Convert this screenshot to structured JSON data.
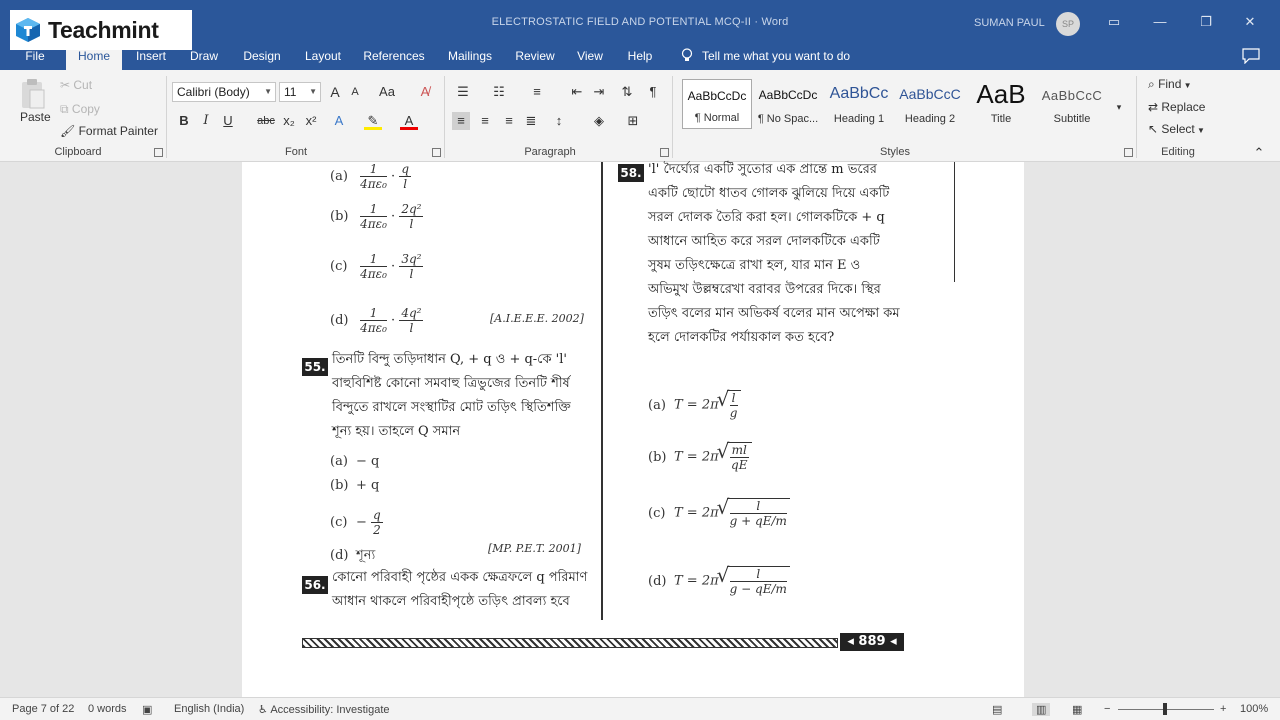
{
  "brand": {
    "name": "Teachmint"
  },
  "titlebar": {
    "doc_title": "ELECTROSTATIC FIELD AND POTENTIAL MCQ-II  ·  Word",
    "user": "SUMAN PAUL",
    "avatar": "SP"
  },
  "tabs": [
    "File",
    "Home",
    "Insert",
    "Draw",
    "Design",
    "Layout",
    "References",
    "Mailings",
    "Review",
    "View",
    "Help"
  ],
  "tell_me": "Tell me what you want to do",
  "clipboard": {
    "paste": "Paste",
    "cut": "Cut",
    "copy": "Copy",
    "format_painter": "Format Painter",
    "label": "Clipboard"
  },
  "font": {
    "name": "Calibri (Body)",
    "size": "11",
    "label": "Font",
    "bold": "B",
    "italic": "I",
    "underline": "U",
    "strike": "abc",
    "subscript": "x₂",
    "superscript": "x²",
    "grow": "A",
    "shrink": "A",
    "case": "Aa"
  },
  "paragraph": {
    "label": "Paragraph"
  },
  "styles": {
    "label": "Styles",
    "items": [
      {
        "preview": "AaBbCcDc",
        "name": "¶ Normal"
      },
      {
        "preview": "AaBbCcDc",
        "name": "¶ No Spac..."
      },
      {
        "preview": "AaBbCc",
        "name": "Heading 1"
      },
      {
        "preview": "AaBbCcC",
        "name": "Heading 2"
      },
      {
        "preview": "AaB",
        "name": "Title"
      },
      {
        "preview": "AaBbCcC",
        "name": "Subtitle"
      }
    ]
  },
  "editing": {
    "find": "Find",
    "replace": "Replace",
    "select": "Select",
    "label": "Editing"
  },
  "document": {
    "left": {
      "q54_options": [
        {
          "label": "(a)",
          "num": "1",
          "den": "4πε₀",
          "num2": "q",
          "den2": "l"
        },
        {
          "label": "(b)",
          "num": "1",
          "den": "4πε₀",
          "num2": "2q²",
          "den2": "l"
        },
        {
          "label": "(c)",
          "num": "1",
          "den": "4πε₀",
          "num2": "3q²",
          "den2": "l"
        },
        {
          "label": "(d)",
          "num": "1",
          "den": "4πε₀",
          "num2": "4q²",
          "den2": "l"
        }
      ],
      "q54_ref": "[A.I.E.E.E. 2002]",
      "q55_num": "55.",
      "q55_text": "তিনটি বিন্দু তড়িদাধান Q, + q ও + q-কে 'l' বাহুবিশিষ্ট কোনো সমবাহু ত্রিভুজের তিনটি শীর্ষ বিন্দুতে রাখলে সংস্থাটির মোট তড়িৎ স্থিতিশক্তি শূন্য হয়। তাহলে Q সমান",
      "q55_options": [
        {
          "label": "(a)",
          "text": "− q"
        },
        {
          "label": "(b)",
          "text": "+ q"
        },
        {
          "label": "(c)",
          "text": "−",
          "num": "q",
          "den": "2"
        },
        {
          "label": "(d)",
          "text": "শূন্য"
        }
      ],
      "q55_ref": "[MP. P.E.T. 2001]",
      "q56_num": "56.",
      "q56_text": "কোনো পরিবাহী পৃষ্ঠের একক ক্ষেত্রফলে q পরিমাণ আধান থাকলে পরিবাহীপৃষ্ঠে তড়িৎ প্রাবল্য হবে"
    },
    "right": {
      "q58_num": "58.",
      "q58_text": "'l' দৈর্ঘ্যের একটি সুতোর এক প্রান্তে m ভরের একটি ছোটো ধাতব গোলক ঝুলিয়ে দিয়ে একটি সরল দোলক তৈরি করা হল। গোলকটিকে + q আধানে আহিত করে সরল দোলকটিকে একটি সুষম তড়িৎক্ষেত্রে রাখা হল, যার মান E ও অভিমুখ উল্লম্বরেখা বরাবর উপরের দিকে। স্থির তড়িৎ বলের মান অভিকর্ষ বলের মান অপেক্ষা কম হলে দোলকটির পর্যায়কাল কত হবে?",
      "q58_options": [
        {
          "label": "(a)",
          "prefix": "T = 2π",
          "num": "l",
          "den": "g"
        },
        {
          "label": "(b)",
          "prefix": "T = 2π",
          "num": "ml",
          "den": "qE"
        },
        {
          "label": "(c)",
          "prefix": "T = 2π",
          "num": "l",
          "den": "g + qE/m"
        },
        {
          "label": "(d)",
          "prefix": "T = 2π",
          "num": "l",
          "den": "g − qE/m"
        }
      ]
    },
    "page_number": "889"
  },
  "status": {
    "page": "Page 7 of 22",
    "words": "0 words",
    "language": "English (India)",
    "accessibility": "Accessibility: Investigate",
    "zoom": "100%"
  }
}
